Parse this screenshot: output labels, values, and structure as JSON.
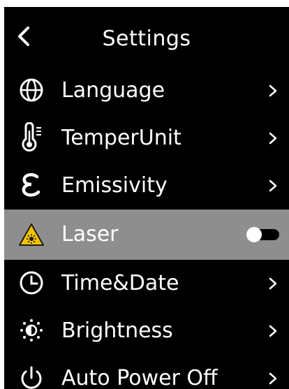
{
  "header": {
    "title": "Settings",
    "back_icon": "chevron-left-icon"
  },
  "menu": [
    {
      "label": "Language",
      "icon": "globe-icon",
      "control": "chevron"
    },
    {
      "label": "TemperUnit",
      "icon": "thermometer-icon",
      "control": "chevron"
    },
    {
      "label": "Emissivity",
      "icon": "epsilon-icon",
      "control": "chevron"
    },
    {
      "label": "Laser",
      "icon": "laser-warning-icon",
      "control": "toggle",
      "toggle_state": "off",
      "selected": true
    },
    {
      "label": "Time&Date",
      "icon": "clock-icon",
      "control": "chevron"
    },
    {
      "label": "Brightness",
      "icon": "brightness-icon",
      "control": "chevron"
    },
    {
      "label": "Auto Power Off",
      "icon": "power-icon",
      "control": "chevron"
    }
  ],
  "colors": {
    "background": "#000000",
    "selected_row": "#8e8e8e",
    "text": "#ffffff",
    "laser_icon": "#f2c200"
  }
}
